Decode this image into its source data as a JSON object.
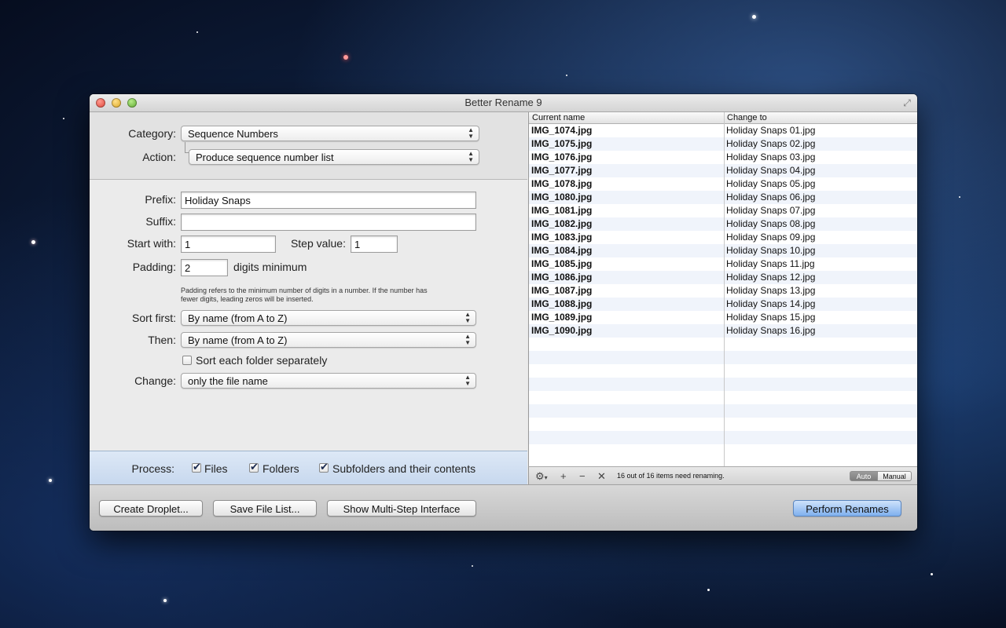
{
  "window": {
    "title": "Better Rename 9"
  },
  "left": {
    "category_label": "Category:",
    "category_value": "Sequence Numbers",
    "action_label": "Action:",
    "action_value": "Produce sequence number list",
    "prefix_label": "Prefix:",
    "prefix_value": "Holiday Snaps",
    "suffix_label": "Suffix:",
    "suffix_value": "",
    "start_label": "Start with:",
    "start_value": "1",
    "step_label": "Step value:",
    "step_value": "1",
    "padding_label": "Padding:",
    "padding_value": "2",
    "padding_suffix": "digits minimum",
    "padding_hint_line1": "Padding refers to the minimum number of digits in a number. If the number has",
    "padding_hint_line2": "fewer digits, leading zeros will be inserted.",
    "sort_first_label": "Sort first:",
    "sort_first_value": "By name (from A to Z)",
    "then_label": "Then:",
    "then_value": "By name (from A to Z)",
    "sort_each_label": "Sort each folder separately",
    "sort_each_checked": false,
    "change_label": "Change:",
    "change_value": "only the file name"
  },
  "process": {
    "label": "Process:",
    "files_label": "Files",
    "folders_label": "Folders",
    "subfolders_label": "Subfolders and their contents"
  },
  "table": {
    "col_current": "Current name",
    "col_change": "Change to",
    "rows": [
      {
        "current": "IMG_1074.jpg",
        "new": "Holiday Snaps 01.jpg"
      },
      {
        "current": "IMG_1075.jpg",
        "new": "Holiday Snaps 02.jpg"
      },
      {
        "current": "IMG_1076.jpg",
        "new": "Holiday Snaps 03.jpg"
      },
      {
        "current": "IMG_1077.jpg",
        "new": "Holiday Snaps 04.jpg"
      },
      {
        "current": "IMG_1078.jpg",
        "new": "Holiday Snaps 05.jpg"
      },
      {
        "current": "IMG_1080.jpg",
        "new": "Holiday Snaps 06.jpg"
      },
      {
        "current": "IMG_1081.jpg",
        "new": "Holiday Snaps 07.jpg"
      },
      {
        "current": "IMG_1082.jpg",
        "new": "Holiday Snaps 08.jpg"
      },
      {
        "current": "IMG_1083.jpg",
        "new": "Holiday Snaps 09.jpg"
      },
      {
        "current": "IMG_1084.jpg",
        "new": "Holiday Snaps 10.jpg"
      },
      {
        "current": "IMG_1085.jpg",
        "new": "Holiday Snaps 11.jpg"
      },
      {
        "current": "IMG_1086.jpg",
        "new": "Holiday Snaps 12.jpg"
      },
      {
        "current": "IMG_1087.jpg",
        "new": "Holiday Snaps 13.jpg"
      },
      {
        "current": "IMG_1088.jpg",
        "new": "Holiday Snaps 14.jpg"
      },
      {
        "current": "IMG_1089.jpg",
        "new": "Holiday Snaps 15.jpg"
      },
      {
        "current": "IMG_1090.jpg",
        "new": "Holiday Snaps 16.jpg"
      }
    ],
    "status": "16 out of 16 items need renaming.",
    "mode_auto": "Auto",
    "mode_manual": "Manual"
  },
  "footer": {
    "droplet_label": "Create Droplet...",
    "save_list_label": "Save File List...",
    "multistep_label": "Show Multi-Step Interface",
    "perform_label": "Perform Renames"
  },
  "icons": {
    "gear": "gear-icon",
    "add": "plus-icon",
    "remove": "minus-icon",
    "clear": "close-icon"
  }
}
